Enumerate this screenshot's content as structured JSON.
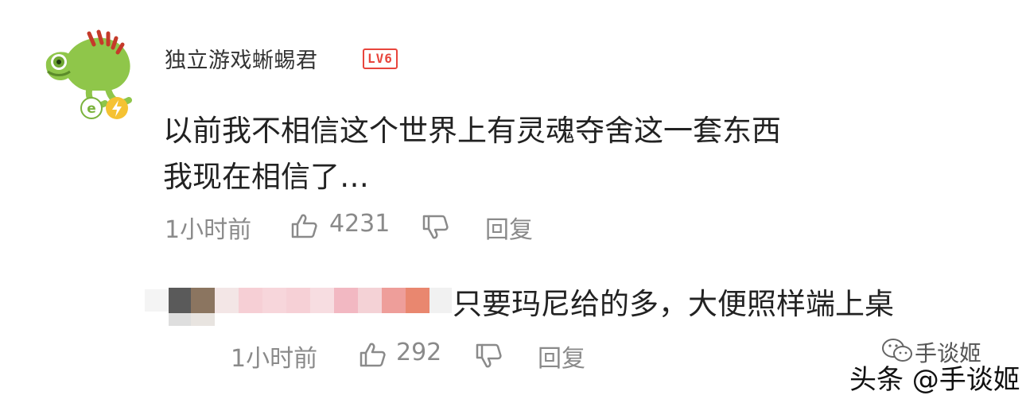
{
  "comment": {
    "username": "独立游戏蜥蜴君",
    "level_badge": "LV6",
    "text_line1": "以前我不相信这个世界上有灵魂夺舍这一套东西",
    "text_line2": "我现在相信了…",
    "time": "1小时前",
    "like_count": "4231",
    "reply_label": "回复",
    "colors": {
      "level": "#e8453c",
      "avatar_green": "#8fc64a",
      "bolt": "#f5c232"
    }
  },
  "reply": {
    "text": "只要玛尼给的多，大便照样端上桌",
    "time": "1小时前",
    "like_count": "292",
    "reply_label": "回复",
    "redacted_colors": [
      "#5a5a5a",
      "#8b7560",
      "#f3e6e6",
      "#f6cfd5",
      "#f2b8c2",
      "#f4c5cb",
      "#f0a7b4",
      "#f2c0c8",
      "#ee9e9a",
      "#e9876f",
      "#f1f1f1"
    ]
  },
  "watermark": {
    "top": "手谈姬",
    "main": "头条 @手谈姬"
  },
  "icons": {
    "avatar": "chameleon-avatar",
    "like": "thumbs-up-icon",
    "dislike": "thumbs-down-icon",
    "wechat": "wechat-icon"
  }
}
